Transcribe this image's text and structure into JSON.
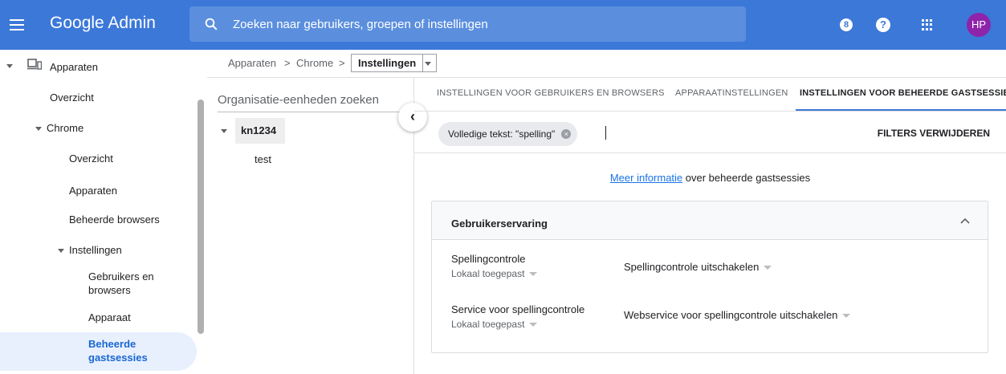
{
  "topbar": {
    "brand": "Google Admin",
    "search_placeholder": "Zoeken naar gebruikers, groepen of instellingen",
    "support_glyph": "8",
    "help_glyph": "?",
    "avatar": "HP",
    "colors": {
      "bar": "#3c78d8",
      "avatar": "#8e24aa"
    }
  },
  "leftnav": {
    "devices": "Apparaten",
    "overview": "Overzicht",
    "chrome": "Chrome",
    "chrome_overview": "Overzicht",
    "chrome_devices": "Apparaten",
    "managed_browsers": "Beheerde browsers",
    "settings": "Instellingen",
    "users_browsers_1": "Gebruikers en",
    "users_browsers_2": "browsers",
    "device": "Apparaat",
    "guest_1": "Beheerde",
    "guest_2": "gastsessies"
  },
  "breadcrumb": {
    "item1": "Apparaten",
    "item2": "Chrome",
    "current": "Instellingen",
    "separator": ">"
  },
  "org": {
    "search_label": "Organisatie-eenheden zoeken",
    "root": "kn1234",
    "child": "test",
    "collapse_glyph": "‹"
  },
  "tabs": {
    "users_browsers": "INSTELLINGEN VOOR GEBRUIKERS EN BROWSERS",
    "device": "APPARAATINSTELLINGEN",
    "guest": "INSTELLINGEN VOOR BEHEERDE GASTSESSIES"
  },
  "filter": {
    "chip": "Volledige tekst: \"spelling\"",
    "chip_close": "×",
    "clear": "FILTERS VERWIJDEREN"
  },
  "info": {
    "link": "Meer informatie",
    "text": " over beheerde gastsessies"
  },
  "card": {
    "title": "Gebruikerservaring",
    "settings": [
      {
        "name": "Spellingcontrole",
        "scope": "Lokaal toegepast",
        "value": "Spellingcontrole uitschakelen"
      },
      {
        "name": "Service voor spellingcontrole",
        "scope": "Lokaal toegepast",
        "value": "Webservice voor spellingcontrole uitschakelen"
      }
    ]
  }
}
